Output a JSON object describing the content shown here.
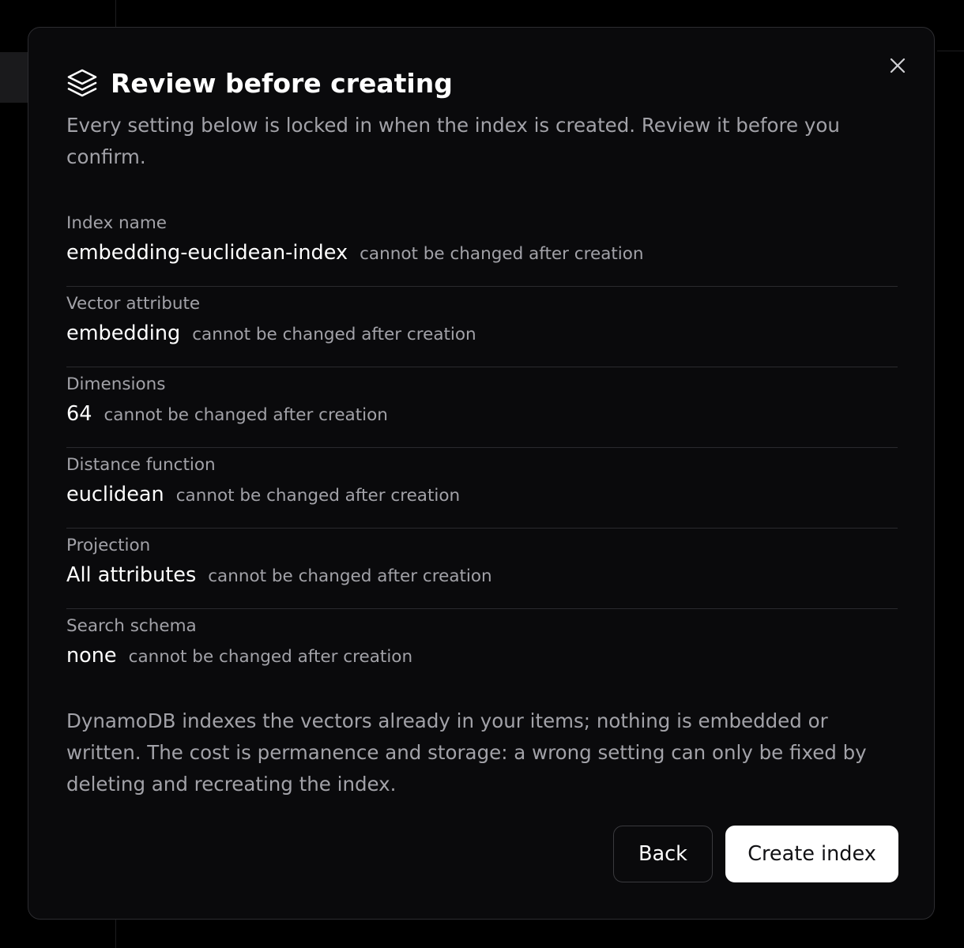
{
  "dialog": {
    "title": "Review before creating",
    "subtitle": "Every setting below is locked in when the index is created. Review it before you confirm.",
    "icon": "layers-icon",
    "close_icon": "close-icon"
  },
  "fields": [
    {
      "label": "Index name",
      "value": "embedding-euclidean-index",
      "note": "cannot be changed after creation"
    },
    {
      "label": "Vector attribute",
      "value": "embedding",
      "note": "cannot be changed after creation"
    },
    {
      "label": "Dimensions",
      "value": "64",
      "note": "cannot be changed after creation"
    },
    {
      "label": "Distance function",
      "value": "euclidean",
      "note": "cannot be changed after creation"
    },
    {
      "label": "Projection",
      "value": "All attributes",
      "note": "cannot be changed after creation"
    },
    {
      "label": "Search schema",
      "value": "none",
      "note": "cannot be changed after creation"
    }
  ],
  "footnote": "DynamoDB indexes the vectors already in your items; nothing is embedded or written. The cost is permanence and storage: a wrong setting can only be fixed by deleting and recreating the index.",
  "actions": {
    "back_label": "Back",
    "create_label": "Create index"
  },
  "colors": {
    "background": "#000000",
    "dialog_bg": "#0a0a0c",
    "dialog_border": "#2c2c30",
    "text_primary": "#ffffff",
    "text_muted": "#a2a2a8",
    "primary_button_bg": "#ffffff"
  }
}
